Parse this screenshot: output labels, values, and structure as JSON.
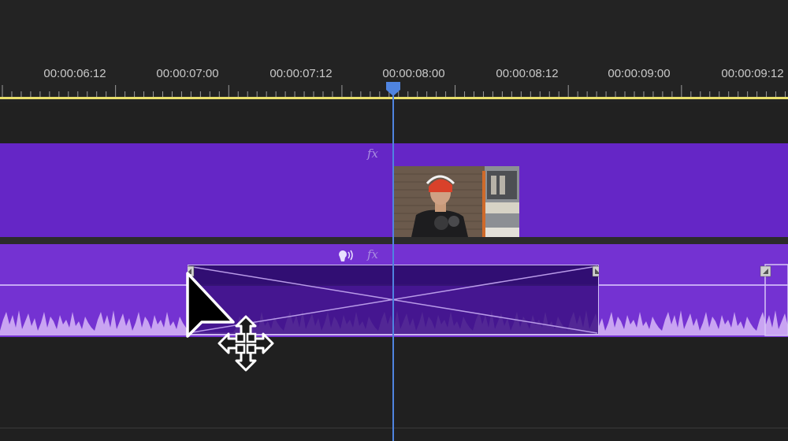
{
  "timeline": {
    "timecodes": [
      "00:00:06:12",
      "00:00:07:00",
      "00:00:07:12",
      "00:00:08:00",
      "00:00:08:12",
      "00:00:09:00",
      "00:00:09:12"
    ],
    "playhead_timecode": "00:00:08:00"
  },
  "tracks": {
    "video": {
      "fx_label": "fx"
    },
    "audio": {
      "fx_label": "fx"
    }
  },
  "colors": {
    "video_clip": "#6526c6",
    "audio_clip": "#7432d2",
    "transition": "#3d1285",
    "waveform": "#c9a4f2",
    "playhead": "#4f84e0",
    "work_area_bar": "#e9df6b"
  },
  "icons": [
    "playhead-icon",
    "voice-icon",
    "fx-icon",
    "keyframe-icon",
    "cursor-arrow-icon",
    "move-icon"
  ]
}
